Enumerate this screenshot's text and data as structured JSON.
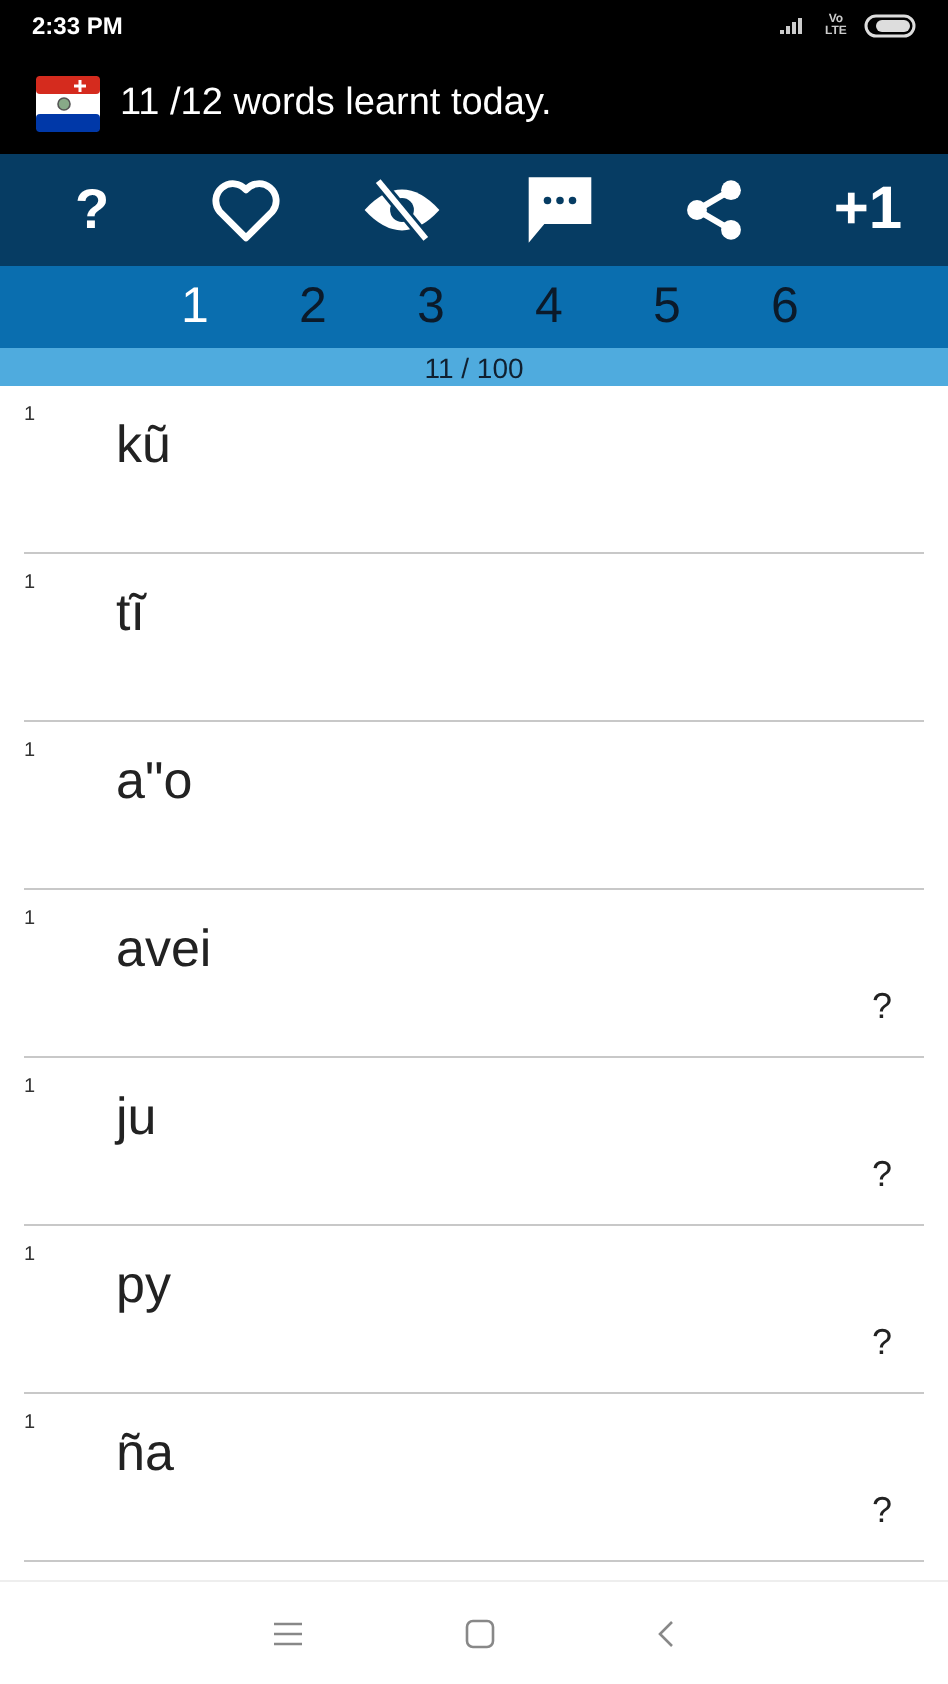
{
  "status_bar": {
    "time": "2:33 PM",
    "network": "Vo LTE"
  },
  "header": {
    "title": "11 /12 words learnt today."
  },
  "toolbar": [
    {
      "kind": "help",
      "label": "?"
    },
    {
      "kind": "heart"
    },
    {
      "kind": "hide"
    },
    {
      "kind": "comment"
    },
    {
      "kind": "share"
    },
    {
      "kind": "plus",
      "label": "+1"
    }
  ],
  "tabs": [
    {
      "label": "1",
      "selected": true
    },
    {
      "label": "2",
      "selected": false
    },
    {
      "label": "3",
      "selected": false
    },
    {
      "label": "4",
      "selected": false
    },
    {
      "label": "5",
      "selected": false
    },
    {
      "label": "6",
      "selected": false
    }
  ],
  "progress": {
    "text": "11 / 100"
  },
  "words": [
    {
      "count": "1",
      "word": "kũ"
    },
    {
      "count": "1",
      "word": "tĩ"
    },
    {
      "count": "1",
      "word": "a\"o"
    },
    {
      "count": "1",
      "word": "avei",
      "hint": "?"
    },
    {
      "count": "1",
      "word": "ju",
      "hint": "?"
    },
    {
      "count": "1",
      "word": "py",
      "hint": "?"
    },
    {
      "count": "1",
      "word": "ña",
      "hint": "?"
    }
  ]
}
